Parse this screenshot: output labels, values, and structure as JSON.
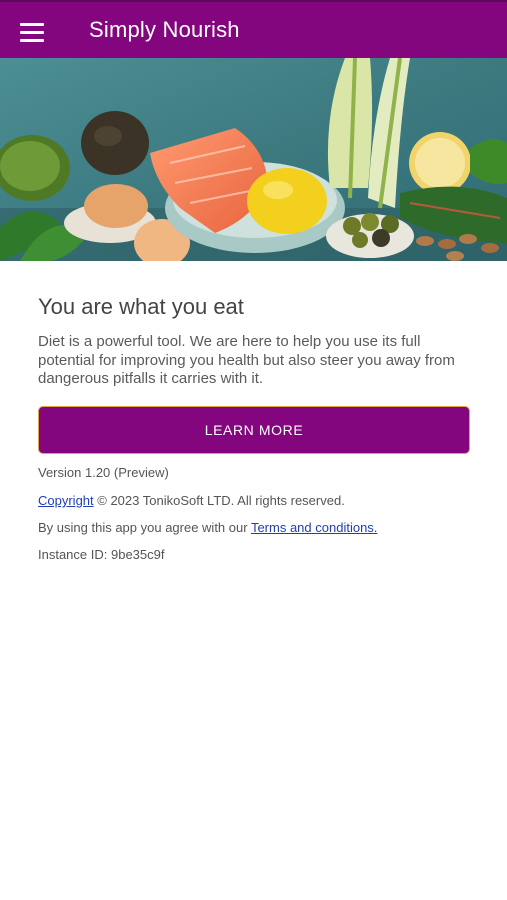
{
  "app": {
    "title": "Simply Nourish"
  },
  "hero": {
    "image_name": "healthy-food-banner"
  },
  "main": {
    "headline": "You are what you eat",
    "description": "Diet is a powerful tool. We are here to help you use its full potential for improving you health but also steer you away from dangerous pitfalls it carries with it.",
    "learn_more_label": "LEARN MORE"
  },
  "footer": {
    "version": "Version 1.20 (Preview)",
    "copyright_link": "Copyright",
    "copyright_text": " © 2023 TonikoSoft LTD. All rights reserved.",
    "terms_prefix": "By using this app you agree with our ",
    "terms_link": "Terms and conditions.",
    "instance_id": "Instance ID: 9be35c9f"
  },
  "colors": {
    "primary": "#84067e",
    "button_border": "#e0a34a",
    "link": "#1f3fb7"
  }
}
